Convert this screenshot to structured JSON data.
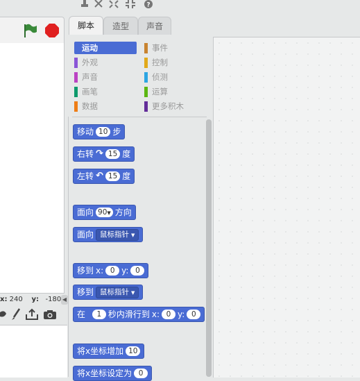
{
  "tabs": [
    {
      "label": "脚本",
      "active": true
    },
    {
      "label": "造型",
      "active": false
    },
    {
      "label": "声音",
      "active": false
    }
  ],
  "stage": {
    "coords": {
      "x_label": "x:",
      "x_value": "240",
      "y_label": "y:",
      "y_value": "-180"
    }
  },
  "categories": {
    "left": [
      {
        "label": "运动",
        "color": "#4a6cd4",
        "selected": true
      },
      {
        "label": "外观",
        "color": "#8a55d7"
      },
      {
        "label": "声音",
        "color": "#bb42c3"
      },
      {
        "label": "画笔",
        "color": "#0e9a6c"
      },
      {
        "label": "数据",
        "color": "#ee7d16"
      }
    ],
    "right": [
      {
        "label": "事件",
        "color": "#c88330"
      },
      {
        "label": "控制",
        "color": "#e1a91a"
      },
      {
        "label": "侦测",
        "color": "#2ca5e2"
      },
      {
        "label": "运算",
        "color": "#5cb712"
      },
      {
        "label": "更多积木",
        "color": "#632d99"
      }
    ]
  },
  "blocks": {
    "move": {
      "text": "移动",
      "value": "10",
      "suffix": "步"
    },
    "turn_right": {
      "text": "右转",
      "icon": "rotate-clockwise-icon",
      "value": "15",
      "suffix": "度"
    },
    "turn_left": {
      "text": "左转",
      "icon": "rotate-counterclockwise-icon",
      "value": "15",
      "suffix": "度"
    },
    "point_direction": {
      "text": "面向",
      "value": "90",
      "suffix": "方向"
    },
    "point_towards": {
      "text": "面向",
      "dropdown": "鼠标指针"
    },
    "go_to_xy": {
      "text": "移到",
      "x_label": "x:",
      "x_value": "0",
      "y_label": "y:",
      "y_value": "0"
    },
    "go_to": {
      "text": "移到",
      "dropdown": "鼠标指针"
    },
    "glide": {
      "text": "在",
      "secs": "1",
      "mid": "秒内滑行到",
      "x_label": "x:",
      "x_value": "0",
      "y_label": "y:",
      "y_value": "0"
    },
    "change_x": {
      "text": "将x坐标增加",
      "value": "10"
    },
    "set_x": {
      "text": "将x坐标设定为",
      "value": "0"
    }
  },
  "colors": {
    "motion": "#4a6cd4",
    "green_flag": "#3a8a3a",
    "stop": "#e02020"
  }
}
